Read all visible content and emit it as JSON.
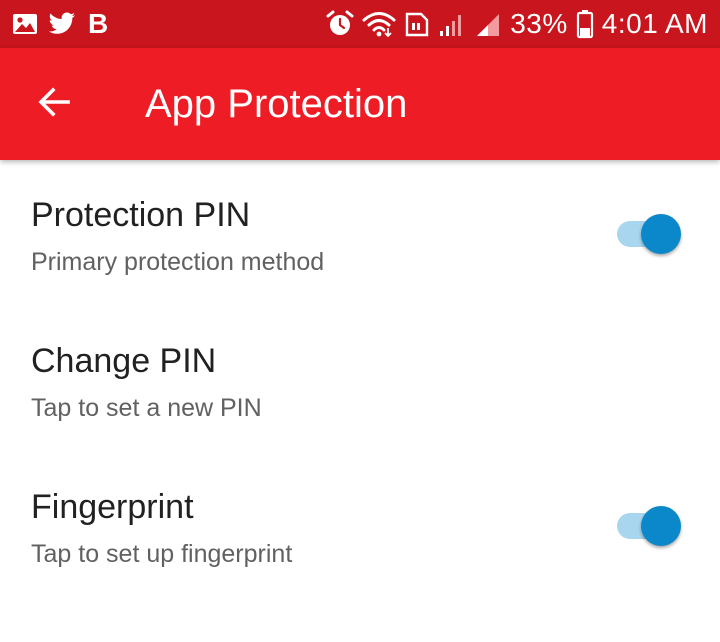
{
  "status_bar": {
    "left_icons": [
      "image-icon",
      "twitter-icon"
    ],
    "b_label": "B",
    "right_icons": [
      "alarm-icon",
      "wifi-icon",
      "volte-icon",
      "signal-icon",
      "signal-icon",
      "battery-icon"
    ],
    "battery_text": "33%",
    "time": "4:01 AM"
  },
  "app_bar": {
    "back_icon": "arrow-left-icon",
    "title": "App Protection"
  },
  "settings": [
    {
      "title": "Protection PIN",
      "summary": "Primary protection method",
      "has_toggle": true,
      "toggle_on": true
    },
    {
      "title": "Change PIN",
      "summary": "Tap to set a new PIN",
      "has_toggle": false
    },
    {
      "title": "Fingerprint",
      "summary": "Tap to set up fingerprint",
      "has_toggle": true,
      "toggle_on": true
    }
  ],
  "colors": {
    "status_bar": "#c9151d",
    "app_bar": "#ee1c25",
    "toggle_thumb": "#0a88c9",
    "toggle_track": "#a9d6ef"
  }
}
